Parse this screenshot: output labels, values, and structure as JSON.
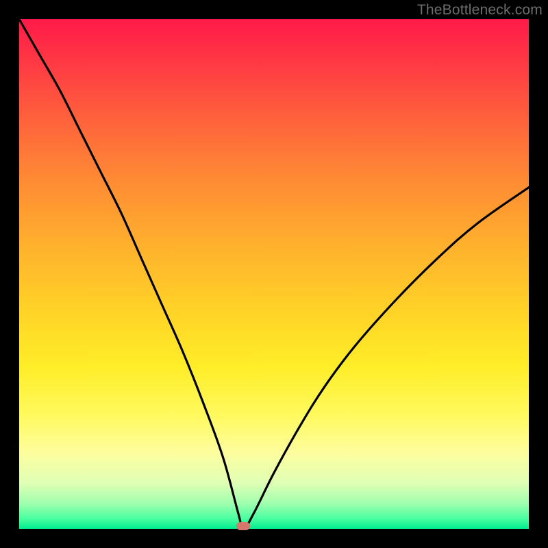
{
  "watermark": "TheBottleneck.com",
  "colors": {
    "frame": "#000000",
    "curve": "#000000",
    "marker": "#d6766d"
  },
  "chart_data": {
    "type": "line",
    "title": "",
    "xlabel": "",
    "ylabel": "",
    "xlim": [
      0,
      100
    ],
    "ylim": [
      0,
      100
    ],
    "grid": false,
    "legend": false,
    "note": "V-shaped bottleneck curve; y is percentage (100 at top of plot, 0 at bottom). Minimum near x≈44.",
    "series": [
      {
        "name": "bottleneck-curve",
        "x": [
          0,
          4,
          8,
          12,
          16,
          20,
          24,
          28,
          32,
          36,
          40,
          43,
          44,
          46,
          50,
          55,
          60,
          66,
          74,
          82,
          90,
          100
        ],
        "y": [
          100,
          93,
          86,
          78,
          70,
          62,
          53,
          44,
          35,
          25,
          14,
          3,
          0,
          3,
          11,
          20,
          28,
          36,
          45,
          53,
          60,
          67
        ]
      }
    ],
    "marker": {
      "x": 44,
      "y": 0
    },
    "gradient_stops": [
      {
        "pct": 0,
        "color": "#ff1a49"
      },
      {
        "pct": 10,
        "color": "#ff3e43"
      },
      {
        "pct": 22,
        "color": "#ff6a3a"
      },
      {
        "pct": 33,
        "color": "#ff8f33"
      },
      {
        "pct": 45,
        "color": "#ffb22d"
      },
      {
        "pct": 57,
        "color": "#ffd227"
      },
      {
        "pct": 68,
        "color": "#ffed28"
      },
      {
        "pct": 78,
        "color": "#fffa60"
      },
      {
        "pct": 85,
        "color": "#fdfd9e"
      },
      {
        "pct": 91,
        "color": "#e0ffb4"
      },
      {
        "pct": 95,
        "color": "#a0ffb0"
      },
      {
        "pct": 98,
        "color": "#4affa0"
      },
      {
        "pct": 100,
        "color": "#00ed8f"
      }
    ]
  }
}
